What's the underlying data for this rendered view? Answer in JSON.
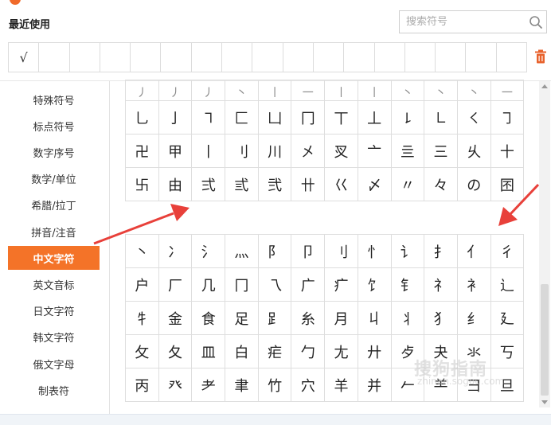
{
  "header": {
    "recent_title": "最近使用"
  },
  "search": {
    "placeholder": "搜索符号",
    "value": ""
  },
  "recent": {
    "items": [
      "√",
      "",
      "",
      "",
      "",
      "",
      "",
      "",
      "",
      "",
      "",
      "",
      "",
      "",
      "",
      "",
      ""
    ]
  },
  "sidebar": {
    "items": [
      {
        "label": "特殊符号"
      },
      {
        "label": "标点符号"
      },
      {
        "label": "数字序号"
      },
      {
        "label": "数学/单位"
      },
      {
        "label": "希腊/拉丁"
      },
      {
        "label": "拼音/注音"
      },
      {
        "label": "中文字符",
        "active": true
      },
      {
        "label": "英文音标"
      },
      {
        "label": "日文字符"
      },
      {
        "label": "韩文字符"
      },
      {
        "label": "俄文字母"
      },
      {
        "label": "制表符"
      }
    ]
  },
  "grid_top": {
    "rows": [
      [
        "丿",
        "丿",
        "丿",
        "丶",
        "丨",
        "一",
        "丨",
        "丨",
        "丶",
        "丶",
        "丶",
        "一"
      ],
      [
        "乚",
        "亅",
        "㇕",
        "匚",
        "凵",
        "冂",
        "丅",
        "丄",
        "㇙",
        "㇗",
        "㇛",
        "㇆"
      ],
      [
        "卍",
        "甲",
        "丨",
        "刂",
        "川",
        "㐅",
        "㕚",
        "亠",
        "亖",
        "三",
        "乆",
        "十"
      ],
      [
        "卐",
        "由",
        "弍",
        "弎",
        "弐",
        "卄",
        "巜",
        "〆",
        "〃",
        "々",
        "の",
        "囨"
      ]
    ]
  },
  "grid_bottom": {
    "rows": [
      [
        "丶",
        "冫",
        "氵",
        "灬",
        "阝",
        "卩",
        "刂",
        "忄",
        "讠",
        "扌",
        "亻",
        "彳"
      ],
      [
        "户",
        "厂",
        "几",
        "冂",
        "乁",
        "广",
        "疒",
        "饣",
        "钅",
        "礻",
        "衤",
        "辶"
      ],
      [
        "牜",
        "金",
        "食",
        "足",
        "𧾷",
        "糸",
        "月",
        "丩",
        "丬",
        "犭",
        "纟",
        "廴"
      ],
      [
        "攵",
        "夂",
        "皿",
        "白",
        "疟",
        "勹",
        "尢",
        "廾",
        "歺",
        "夬",
        "氺",
        "丂"
      ],
      [
        "丙",
        "癶",
        "耂",
        "聿",
        "竹",
        "穴",
        "羊",
        "并",
        "𠂉",
        "⺷",
        "彐",
        "旦"
      ]
    ]
  },
  "watermark": {
    "text": "搜狗指南",
    "sub": "zhinan.sogou.com"
  },
  "colors": {
    "accent": "#f47328",
    "arrow": "#e8403a",
    "trash": "#e8622c"
  }
}
